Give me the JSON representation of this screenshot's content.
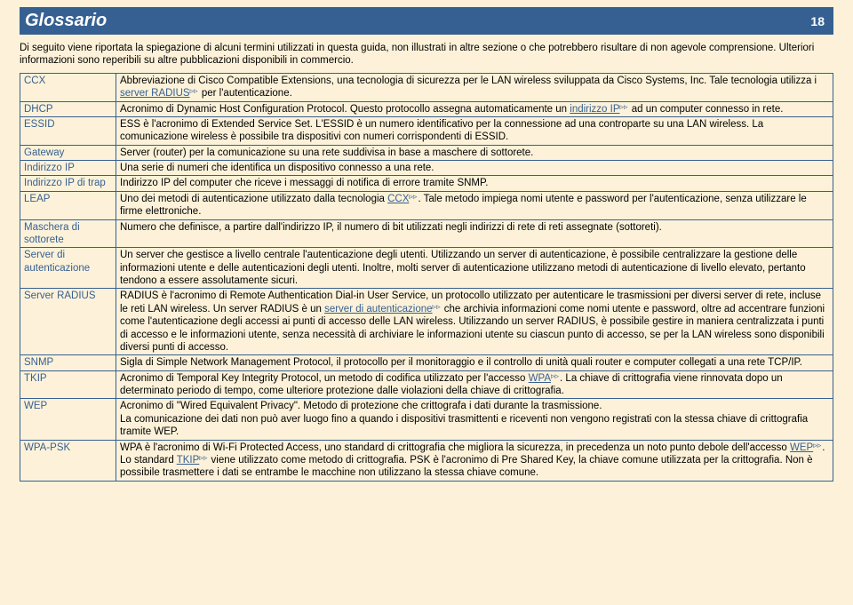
{
  "header": {
    "title": "Glossario",
    "page_number": "18"
  },
  "intro": "Di seguito viene riportata la spiegazione di alcuni termini utilizzati in questa guida, non illustrati in altre sezione o che potrebbero risultare di non agevole comprensione. Ulteriori informazioni sono reperibili su altre pubblicazioni disponibili in commercio.",
  "entries": [
    {
      "term": "CCX",
      "segments": [
        {
          "t": "text",
          "v": "Abbreviazione di Cisco Compatible Extensions, una tecnologia di sicurezza per le LAN wireless sviluppata da Cisco Systems, Inc. Tale tecnologia utilizza i "
        },
        {
          "t": "xref",
          "v": "server RADIUS"
        },
        {
          "t": "text",
          "v": " per l'autenticazione."
        }
      ]
    },
    {
      "term": "DHCP",
      "segments": [
        {
          "t": "text",
          "v": "Acronimo di Dynamic Host Configuration Protocol. Questo protocollo assegna automaticamente un "
        },
        {
          "t": "xref",
          "v": "indirizzo IP"
        },
        {
          "t": "text",
          "v": " ad un computer connesso in rete."
        }
      ]
    },
    {
      "term": "ESSID",
      "segments": [
        {
          "t": "text",
          "v": "ESS è l'acronimo di Extended Service Set. L'ESSID è un numero identificativo per la connessione ad una controparte su una LAN wireless. La comunicazione wireless è possibile tra dispositivi con numeri corrispondenti di ESSID."
        }
      ]
    },
    {
      "term": "Gateway",
      "segments": [
        {
          "t": "text",
          "v": "Server (router) per la comunicazione su una rete suddivisa in base a maschere di sottorete."
        }
      ]
    },
    {
      "term": "Indirizzo IP",
      "segments": [
        {
          "t": "text",
          "v": "Una serie di numeri che identifica un dispositivo connesso a una rete."
        }
      ]
    },
    {
      "term": "Indirizzo IP di trap",
      "segments": [
        {
          "t": "text",
          "v": "Indirizzo IP del computer che riceve i messaggi di notifica di errore tramite SNMP."
        }
      ]
    },
    {
      "term": "LEAP",
      "segments": [
        {
          "t": "text",
          "v": "Uno dei metodi di autenticazione utilizzato dalla tecnologia "
        },
        {
          "t": "xref",
          "v": "CCX"
        },
        {
          "t": "text",
          "v": ". Tale metodo impiega nomi utente e password per l'autenticazione, senza utilizzare le firme elettroniche."
        }
      ]
    },
    {
      "term": "Maschera di sottorete",
      "segments": [
        {
          "t": "text",
          "v": "Numero che definisce, a partire dall'indirizzo IP, il numero di bit utilizzati negli indirizzi di rete di reti assegnate (sottoreti)."
        }
      ]
    },
    {
      "term": "Server di autenticazione",
      "segments": [
        {
          "t": "text",
          "v": "Un server che gestisce a livello centrale l'autenticazione degli utenti. Utilizzando un server di autenticazione, è possibile centralizzare la gestione delle informazioni utente e delle autenticazioni degli utenti. Inoltre, molti server di autenticazione utilizzano metodi di autenticazione di livello elevato, pertanto tendono a essere assolutamente sicuri."
        }
      ]
    },
    {
      "term": "Server RADIUS",
      "segments": [
        {
          "t": "text",
          "v": "RADIUS è l'acronimo di Remote Authentication Dial-in User Service, un protocollo utilizzato per autenticare le trasmissioni per diversi server di rete, incluse le reti LAN wireless. Un server RADIUS è un "
        },
        {
          "t": "xref",
          "v": "server di autenticazione"
        },
        {
          "t": "text",
          "v": " che archivia informazioni come nomi utente e password, oltre ad accentrare funzioni come l'autenticazione degli accessi ai punti di accesso delle LAN wireless. Utilizzando un server RADIUS, è possibile gestire in maniera centralizzata i punti di accesso e le informazioni utente, senza necessità di archiviare le informazioni utente su ciascun punto di accesso, se per la LAN wireless sono disponibili diversi punti di accesso."
        }
      ]
    },
    {
      "term": "SNMP",
      "segments": [
        {
          "t": "text",
          "v": "Sigla di Simple Network Management Protocol, il protocollo per il monitoraggio e il controllo di unità quali router e computer collegati a una rete TCP/IP."
        }
      ]
    },
    {
      "term": "TKIP",
      "segments": [
        {
          "t": "text",
          "v": "Acronimo di Temporal Key Integrity Protocol, un metodo di codifica utilizzato per l'accesso "
        },
        {
          "t": "xref",
          "v": "WPA"
        },
        {
          "t": "text",
          "v": ". La chiave di crittografia viene rinnovata dopo un determinato periodo di tempo, come ulteriore protezione dalle violazioni della chiave di crittografia."
        }
      ]
    },
    {
      "term": "WEP",
      "segments": [
        {
          "t": "text",
          "v": "Acronimo di \"Wired Equivalent Privacy\". Metodo di protezione che crittografa i dati durante la trasmissione.\nLa comunicazione dei dati non può aver luogo fino a quando i dispositivi trasmittenti e riceventi non vengono registrati con la stessa chiave di crittografia tramite WEP."
        }
      ]
    },
    {
      "term": "WPA-PSK",
      "segments": [
        {
          "t": "text",
          "v": "WPA è l'acronimo di Wi-Fi Protected Access, uno standard di crittografia che migliora la sicurezza, in precedenza un noto punto debole dell'accesso "
        },
        {
          "t": "xref",
          "v": "WEP"
        },
        {
          "t": "text",
          "v": ". Lo standard "
        },
        {
          "t": "xref",
          "v": "TKIP"
        },
        {
          "t": "text",
          "v": " viene utilizzato come metodo di crittografia. PSK è l'acronimo di Pre Shared Key, la chiave comune utilizzata per la crittografia. Non è possibile trasmettere i dati se entrambe le macchine non utilizzano la stessa chiave comune."
        }
      ]
    }
  ]
}
